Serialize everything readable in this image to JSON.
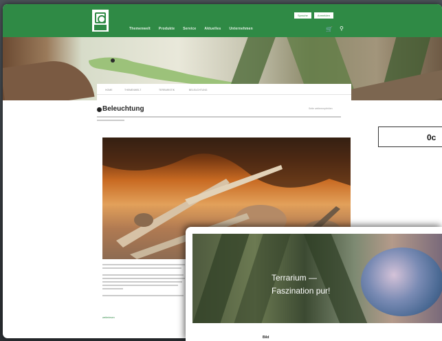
{
  "header": {
    "nav": [
      "Themenwelt",
      "Produkte",
      "Service",
      "Aktuelles",
      "Unternehmen"
    ],
    "top_buttons": [
      "Sprache",
      "Anmelden"
    ],
    "cart_icon": "cart-icon",
    "search_icon": "search-icon"
  },
  "breadcrumb": [
    "HOME",
    "THEMENWELT",
    "TERRARISTIK",
    "BELEUCHTUNG"
  ],
  "page": {
    "title": "Beleuchtung",
    "share": "Seite weiterempfehlen",
    "read_more": "weiterlesen"
  },
  "overlay_label": "0c",
  "second_window": {
    "hero_title_1": "Terrarium —",
    "hero_title_2": "Faszination pur!",
    "subheading": "Bild"
  },
  "colors": {
    "brand": "#2f8a45"
  }
}
